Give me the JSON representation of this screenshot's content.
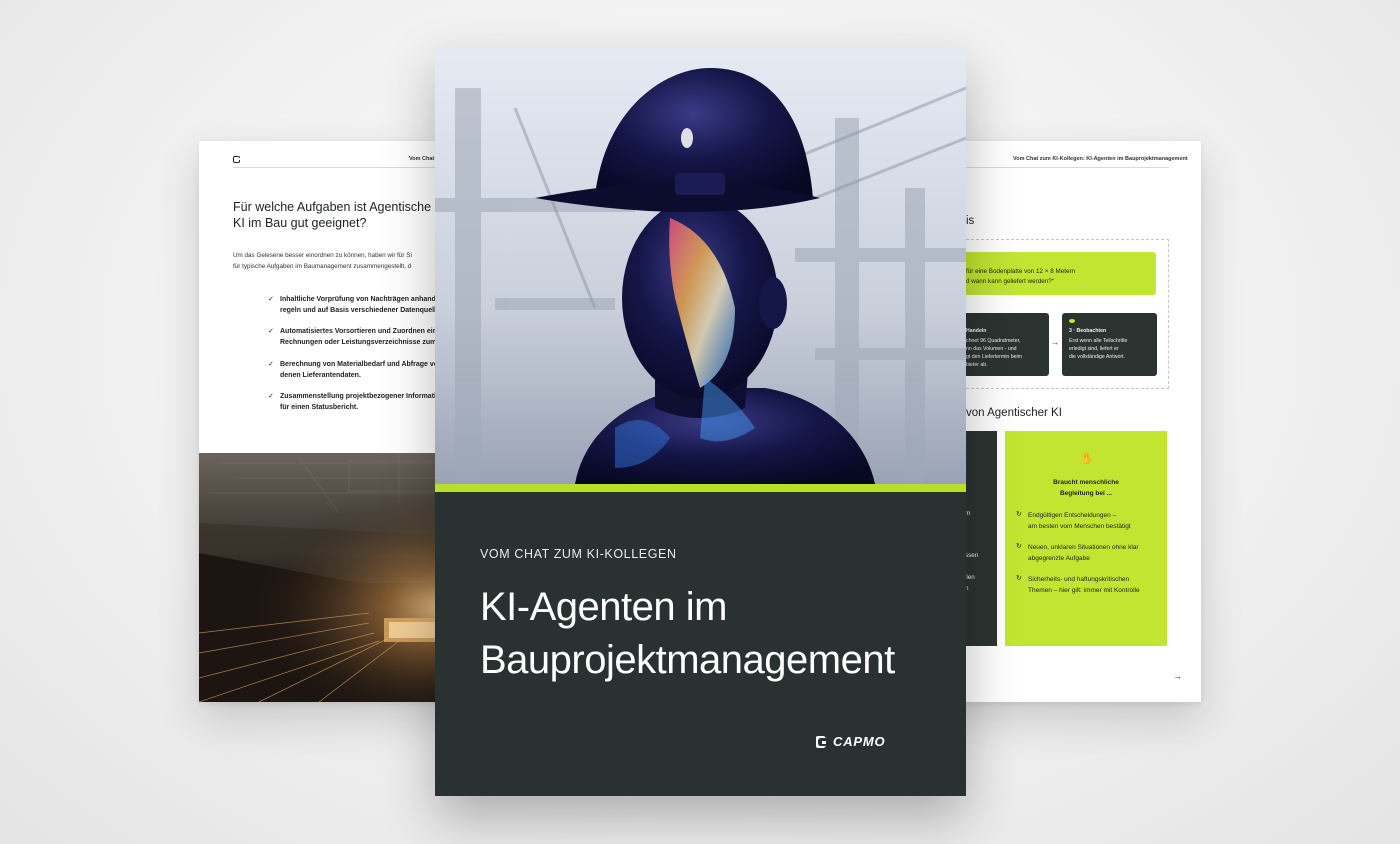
{
  "left_page": {
    "header": "Vom Chat z",
    "heading": [
      "Für welche Aufgaben ist Agentische",
      "KI im Bau gut geeignet?"
    ],
    "intro": [
      "Um das Gelesene besser einordnen zu können, haben wir für Si",
      "für typische Aufgaben im Baumanagement zusammengestellt, d"
    ],
    "items": [
      [
        "Inhaltliche Vorprüfung von Nachträgen anhand",
        "regeln und auf Basis verschiedener Datenquelle"
      ],
      [
        "Automatisiertes Vorsortieren und Zuordnen eing",
        "Rechnungen oder Leistungsverzeichnisse zum p"
      ],
      [
        "Berechnung von Materialbedarf und Abfrage vo",
        "denen Lieferantendaten."
      ],
      [
        "Zusammenstellung projektbezogener Informatio",
        "für einen Statusbericht."
      ]
    ]
  },
  "cover": {
    "eyebrow": "VOM CHAT ZUM KI-KOLLEGEN",
    "title_line1": "KI-Agenten im",
    "title_line2": "Bauprojektmanagement",
    "brand": "CAPMO",
    "accent_color": "#b8e02a",
    "panel_color": "#293230"
  },
  "right_page": {
    "header": "Vom Chat zum KI-Kollegen: KI-Agenten im Bauprojektmanagement",
    "section1_tail": "is",
    "prompt": [
      "für eine Bodenplatte von 12 × 8 Metern",
      "d wann kann geliefert werden?“"
    ],
    "step2": {
      "title": "Handeln",
      "lines": [
        "chnet 96 Quadratmeter,",
        "nn das Volumen - und",
        "gt den Liefertermin beim",
        "bieter ab."
      ]
    },
    "step3": {
      "title": "3 · Beobachten",
      "lines": [
        "Erst wenn alle Teilschritte",
        "erledigt sind, liefert er",
        "die vollständige Antwort."
      ]
    },
    "section2_tail": "von Agentischer KI",
    "dark_col_fragments": [
      "m",
      "ssen",
      "llen",
      "n"
    ],
    "green_card": {
      "title": [
        "Braucht menschliche",
        "Begleitung bei ..."
      ],
      "items": [
        [
          "Endgültigen Entscheidungen –",
          "am besten vom Menschen bestätigt"
        ],
        [
          "Neuen, unklaren Situationen ohne klar",
          "abgegrenzte Aufgabe"
        ],
        [
          "Sicherheits- und haftungskritischen",
          "Themen – hier gilt: immer mit Kontrolle"
        ]
      ]
    },
    "next_arrow": "→"
  }
}
